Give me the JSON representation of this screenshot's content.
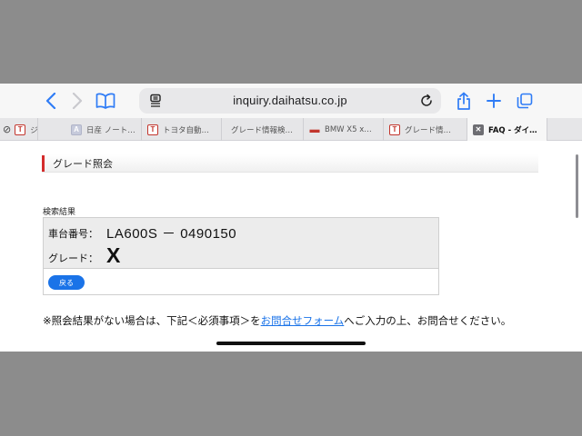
{
  "browser": {
    "url": "inquiry.daihatsu.co.jp",
    "accent_color": "#2f7cf6"
  },
  "tabs": [
    {
      "icon": "toyota-t-favicon",
      "title": "ジ"
    },
    {
      "icon": "generic-favicon",
      "title": "日産 ノート…"
    },
    {
      "icon": "toyota-t-favicon",
      "title": "トヨタ自動…"
    },
    {
      "icon": "none",
      "title": "グレード情報検…"
    },
    {
      "icon": "car-favicon",
      "title": "BMW X5 x…"
    },
    {
      "icon": "toyota-t-favicon",
      "title": "グレード情…"
    },
    {
      "icon": "close-favicon",
      "title": "FAQ - ダイ…",
      "active": true
    }
  ],
  "page": {
    "section_title": "グレード照会",
    "result_caption": "検索結果",
    "chassis_label": "車台番号：",
    "chassis_value": "LA600S － 0490150",
    "grade_label": "グレード：",
    "grade_value": "X",
    "back_button": "戻る",
    "notice_before": "※照会結果がない場合は、下記＜必須事項＞を",
    "notice_link": "お問合せフォーム",
    "notice_after": "へご入力の上、お問合せください。"
  }
}
